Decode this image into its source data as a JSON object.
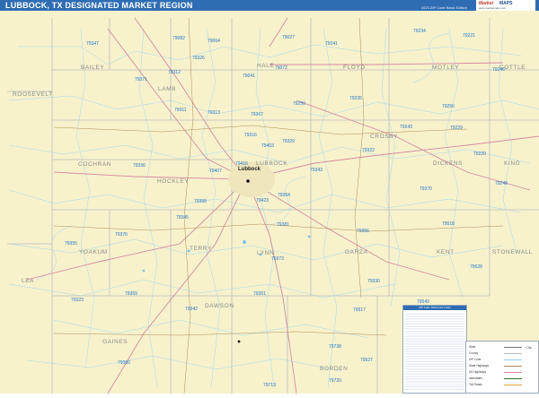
{
  "header": {
    "title": "LUBBOCK, TX DESIGNATED MARKET REGION",
    "edition": "2023 ZIP Code Basic Edition",
    "logo_text_1": "Market",
    "logo_text_2": "MAPS",
    "logo_sub": "www.marketmaps.com"
  },
  "colors": {
    "land": "#f7f2cc",
    "county_line": "#b9b9b9",
    "zip_line": "#9ad0ec",
    "road_red": "#d98fa0",
    "road_brown": "#b08a5a",
    "title_bar": "#2f6db3"
  },
  "counties": [
    "BAILEY",
    "LAMB",
    "HALE",
    "FLOYD",
    "MOTLEY",
    "COTTLE",
    "ROOSEVELT",
    "COCHRAN",
    "HOCKLEY",
    "LUBBOCK",
    "CROSBY",
    "DICKENS",
    "KING",
    "YOAKUM",
    "TERRY",
    "LYNN",
    "GARZA",
    "KENT",
    "STONEWALL",
    "LEA",
    "GAINES",
    "DAWSON",
    "BORDEN"
  ],
  "city": "Lubbock",
  "zips": [
    "79347",
    "79082",
    "79064",
    "79027",
    "79241",
    "79234",
    "79221",
    "79326",
    "79312",
    "79371",
    "79072",
    "79311",
    "79041",
    "79250",
    "79235",
    "79256",
    "79246",
    "79313",
    "79336",
    "79367",
    "79316",
    "79403",
    "79329",
    "79343",
    "79322",
    "79243",
    "79229",
    "79220",
    "79407",
    "79416",
    "79358",
    "79423",
    "79364",
    "79370",
    "79248",
    "79345",
    "79376",
    "79381",
    "79356",
    "79518",
    "79355",
    "79373",
    "79330",
    "79528",
    "79359",
    "79342",
    "79351",
    "79517",
    "79323",
    "79360",
    "79738",
    "79527",
    "79713",
    "79720",
    "79549"
  ],
  "index": {
    "title": "ZIP Code Reference Index"
  },
  "legend": {
    "items": [
      "State",
      "County",
      "ZIP Code",
      "State Highways",
      "US Highways",
      "Interstates",
      "Toll Roads"
    ],
    "inset_label": "City"
  }
}
